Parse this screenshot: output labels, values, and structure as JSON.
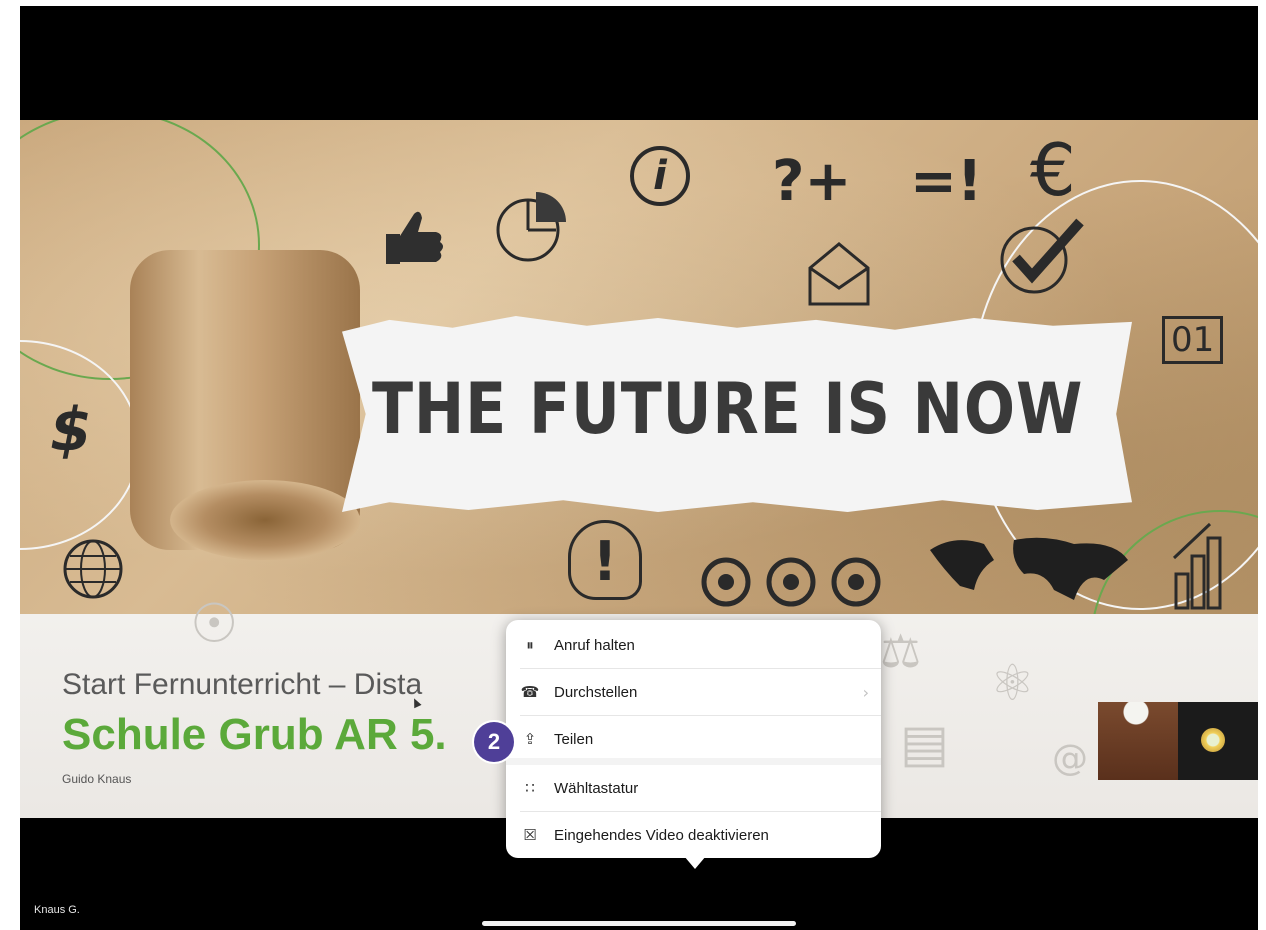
{
  "slide": {
    "headline": "THE FUTURE IS NOW",
    "subtitle": "Start Fernunterricht – Dista",
    "title": "Schule Grub AR 5.",
    "author": "Guido Knaus",
    "doodles": [
      "?+",
      "=!",
      "€",
      "$",
      "01",
      "i",
      "!"
    ]
  },
  "call": {
    "caller_label": "Knaus G."
  },
  "menu": {
    "items": [
      {
        "icon": "pause-icon",
        "glyph": "⏸",
        "label": "Anruf halten",
        "has_chevron": false
      },
      {
        "icon": "transfer-call-icon",
        "glyph": "☎",
        "label": "Durchstellen",
        "has_chevron": true
      },
      {
        "icon": "share-icon",
        "glyph": "⇪",
        "label": "Teilen",
        "has_chevron": false
      },
      {
        "icon": "keypad-icon",
        "glyph": "∷",
        "label": "Wähltastatur",
        "has_chevron": false
      },
      {
        "icon": "video-off-icon",
        "glyph": "☒",
        "label": "Eingehendes Video deaktivieren",
        "has_chevron": false
      }
    ],
    "chevron": "›"
  },
  "annotation": {
    "step_number": "2",
    "color": "#4f3f98"
  },
  "colors": {
    "title_green": "#5ba93a",
    "menu_bg": "#ffffff",
    "background": "#000000"
  }
}
